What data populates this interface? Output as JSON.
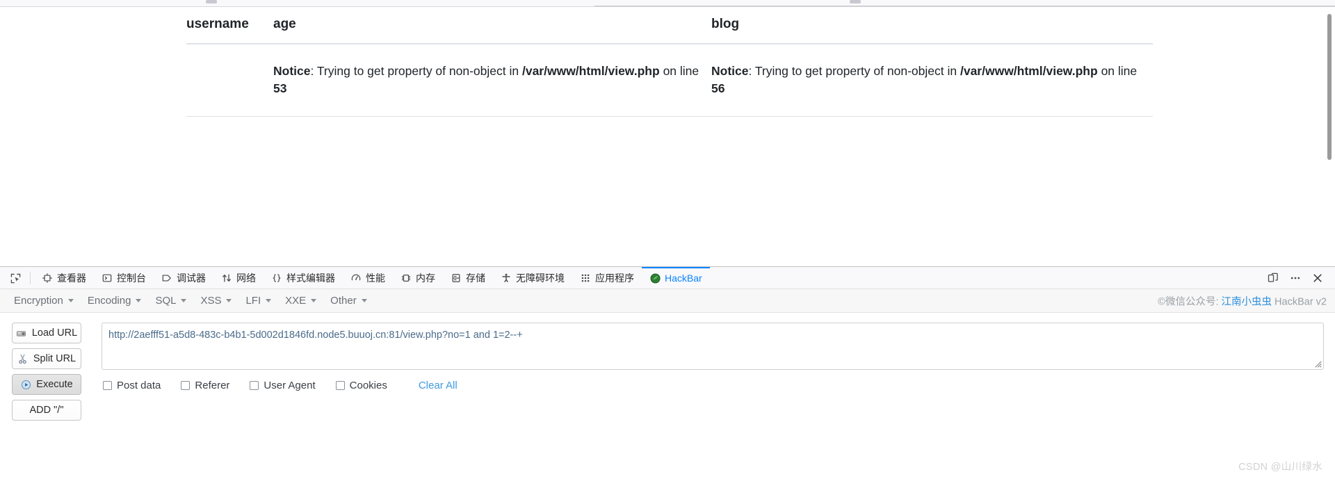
{
  "page": {
    "table": {
      "headers": [
        "username",
        "age",
        "blog"
      ],
      "rows": [
        {
          "username": "",
          "age": {
            "label": "Notice",
            "message": ": Trying to get property of non-object in ",
            "path": "/var/www/html/view.php",
            "line_prefix": " on line ",
            "line": "53"
          },
          "blog": {
            "label": "Notice",
            "message": ": Trying to get property of non-object in ",
            "path": "/var/www/html/view.php",
            "line_prefix": " on line ",
            "line": "56"
          }
        }
      ]
    }
  },
  "devtools": {
    "picker_icon": "element-picker-icon",
    "tabs": [
      {
        "label": "查看器",
        "icon": "inspector-icon",
        "active": false
      },
      {
        "label": "控制台",
        "icon": "console-icon",
        "active": false
      },
      {
        "label": "调试器",
        "icon": "debugger-icon",
        "active": false
      },
      {
        "label": "网络",
        "icon": "network-icon",
        "active": false
      },
      {
        "label": "样式编辑器",
        "icon": "style-editor-icon",
        "active": false
      },
      {
        "label": "性能",
        "icon": "performance-icon",
        "active": false
      },
      {
        "label": "内存",
        "icon": "memory-icon",
        "active": false
      },
      {
        "label": "存储",
        "icon": "storage-icon",
        "active": false
      },
      {
        "label": "无障碍环境",
        "icon": "accessibility-icon",
        "active": false
      },
      {
        "label": "应用程序",
        "icon": "application-icon",
        "active": false
      },
      {
        "label": "HackBar",
        "icon": "hackbar-icon",
        "active": true
      }
    ],
    "right_buttons": [
      {
        "label": "",
        "icon": "responsive-design-mode-icon"
      },
      {
        "label": "",
        "icon": "meatball-menu-icon"
      },
      {
        "label": "",
        "icon": "close-icon"
      }
    ],
    "accent_color": "#0a84ff"
  },
  "hackbar": {
    "menus": [
      "Encryption",
      "Encoding",
      "SQL",
      "XSS",
      "LFI",
      "XXE",
      "Other"
    ],
    "brand": {
      "prefix": "©微信公众号: ",
      "name": "江南小虫虫",
      "suffix": " HackBar v2"
    },
    "buttons": [
      {
        "label": "Load URL",
        "icon": "load-url-icon",
        "pressed": false
      },
      {
        "label": "Split URL",
        "icon": "split-url-icon",
        "pressed": false
      },
      {
        "label": "Execute",
        "icon": "execute-icon",
        "pressed": true
      },
      {
        "label": "ADD \"/\"",
        "icon": "",
        "pressed": false
      }
    ],
    "url_value": "http://2aefff51-a5d8-483c-b4b1-5d002d1846fd.node5.buuoj.cn:81/view.php?no=1 and 1=2--+",
    "url_placeholder": "",
    "options": [
      {
        "label": "Post data",
        "checked": false
      },
      {
        "label": "Referer",
        "checked": false
      },
      {
        "label": "User Agent",
        "checked": false
      },
      {
        "label": "Cookies",
        "checked": false
      }
    ],
    "clear_all_label": "Clear All",
    "link_color": "#3d9ae0"
  },
  "watermark": "CSDN @山川绿水"
}
